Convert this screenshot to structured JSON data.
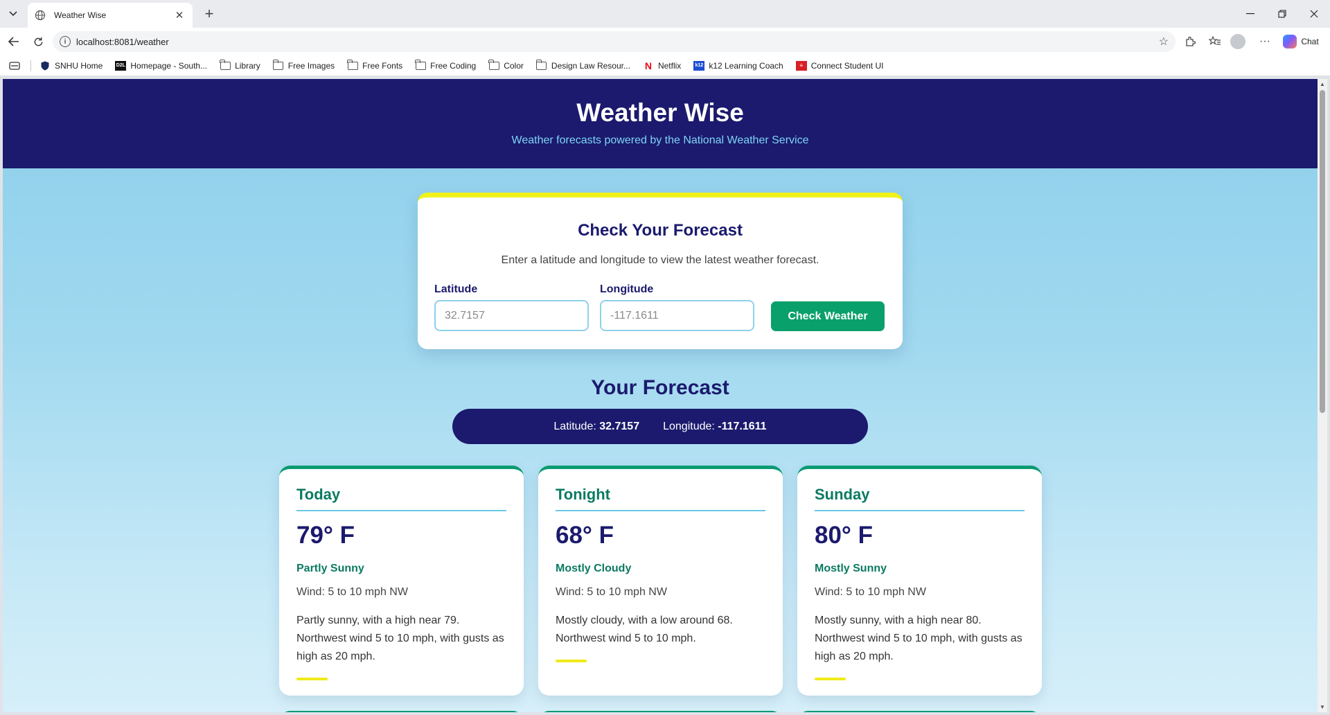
{
  "browser": {
    "tab_title": "Weather Wise",
    "url": "localhost:8081/weather",
    "chat_label": "Chat",
    "bookmarks": [
      {
        "label": "SNHU Home",
        "icon": "shield-icon"
      },
      {
        "label": "Homepage - South...",
        "icon": "d2l-icon"
      },
      {
        "label": "Library",
        "icon": "folder-icon"
      },
      {
        "label": "Free Images",
        "icon": "folder-icon"
      },
      {
        "label": "Free Fonts",
        "icon": "folder-icon"
      },
      {
        "label": "Free Coding",
        "icon": "folder-icon"
      },
      {
        "label": "Color",
        "icon": "folder-icon"
      },
      {
        "label": "Design Law Resour...",
        "icon": "folder-icon"
      },
      {
        "label": "Netflix",
        "icon": "netflix-icon"
      },
      {
        "label": "k12 Learning Coach",
        "icon": "k12-icon"
      },
      {
        "label": "Connect Student UI",
        "icon": "connect-icon"
      }
    ]
  },
  "header": {
    "title": "Weather Wise",
    "subtitle": "Weather forecasts powered by the National Weather Service"
  },
  "form": {
    "title": "Check Your Forecast",
    "description": "Enter a latitude and longitude to view the latest weather forecast.",
    "latitude_label": "Latitude",
    "latitude_placeholder": "32.7157",
    "longitude_label": "Longitude",
    "longitude_placeholder": "-117.1611",
    "button_label": "Check Weather"
  },
  "forecast": {
    "title": "Your Forecast",
    "latitude_label": "Latitude:",
    "latitude_value": "32.7157",
    "longitude_label": "Longitude:",
    "longitude_value": "-117.1611",
    "periods": [
      {
        "name": "Today",
        "temperature": "79° F",
        "short": "Partly Sunny",
        "wind": "Wind: 5 to 10 mph NW",
        "detail": "Partly sunny, with a high near 79. Northwest wind 5 to 10 mph, with gusts as high as 20 mph."
      },
      {
        "name": "Tonight",
        "temperature": "68° F",
        "short": "Mostly Cloudy",
        "wind": "Wind: 5 to 10 mph NW",
        "detail": "Mostly cloudy, with a low around 68. Northwest wind 5 to 10 mph."
      },
      {
        "name": "Sunday",
        "temperature": "80° F",
        "short": "Mostly Sunny",
        "wind": "Wind: 5 to 10 mph NW",
        "detail": "Mostly sunny, with a high near 80. Northwest wind 5 to 10 mph, with gusts as high as 20 mph."
      }
    ]
  },
  "colors": {
    "navy": "#1b1a6e",
    "teal": "#0b7a62",
    "button_green": "#09a06b",
    "accent_yellow": "#f0ea1a",
    "sky": "#9fd8ef"
  }
}
